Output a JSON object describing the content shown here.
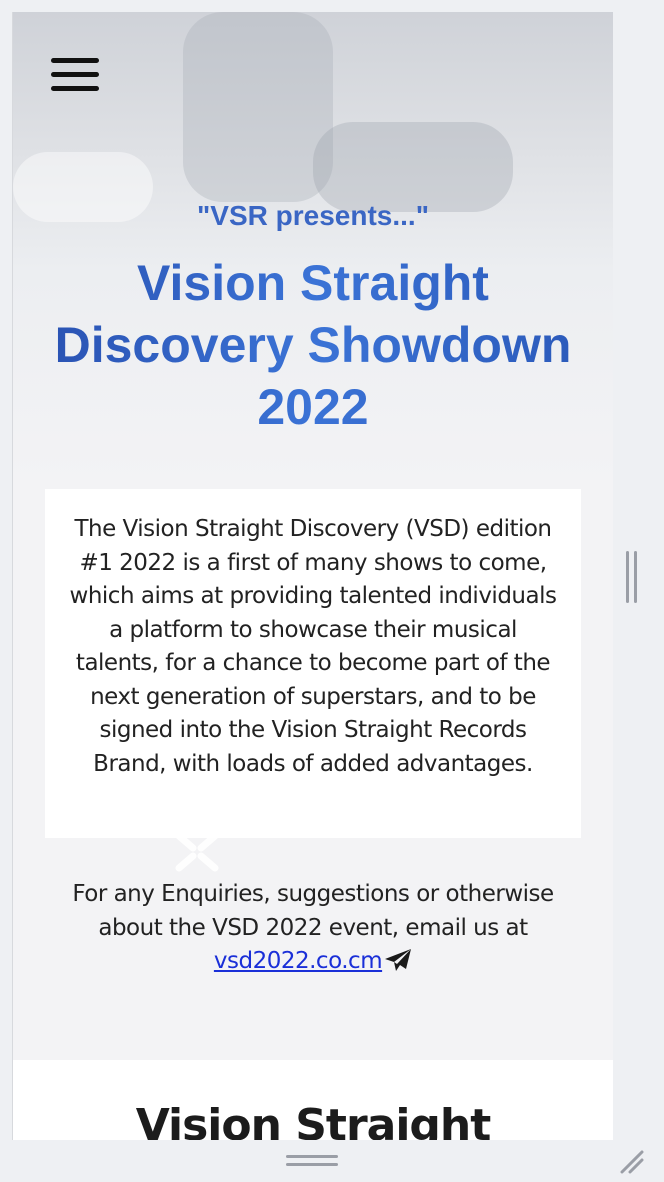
{
  "header": {
    "menu_icon": "hamburger-menu-icon"
  },
  "hero": {
    "presents": "\"VSR presents...\"",
    "title_lines": [
      "Vision Straight",
      "Discovery Showdown",
      "2022"
    ]
  },
  "description": {
    "text": "The Vision Straight Discovery (VSD) edition #1 2022 is a first of many shows to come, which aims at providing talented individuals a platform to showcase their musical talents, for a chance to become part of the next generation of superstars, and to be signed into the Vision Straight Records Brand, with loads of added advantages."
  },
  "enquiry": {
    "text": "For any Enquiries, suggestions or otherwise about the VSD 2022 event, email us at",
    "email": "vsd2022.co.cm",
    "send_icon": "paper-plane-icon"
  },
  "section2": {
    "title": "Vision Straight"
  },
  "colors": {
    "title_blue": "#2f5fc2",
    "link_blue": "#1a2fd8",
    "text": "#222222"
  }
}
